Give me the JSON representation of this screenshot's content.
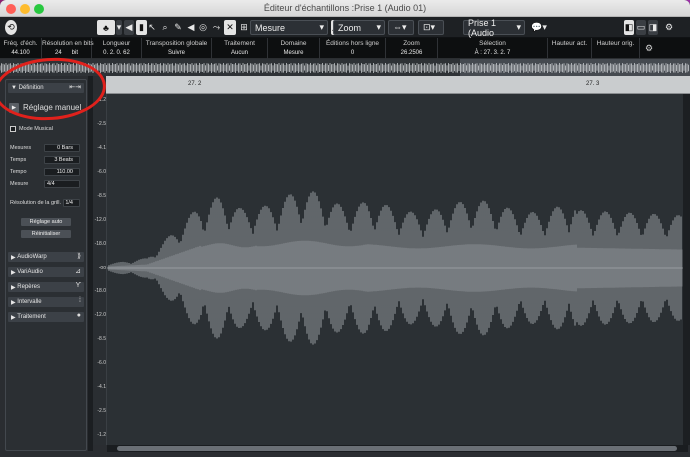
{
  "window": {
    "title": "Éditeur d'échantillons :Prise 1 (Audio 01)"
  },
  "toolbar": {
    "ruler_mode": "Mesure",
    "zoom_mode": "Zoom",
    "take": "Prise 1 (Audio"
  },
  "infobar": [
    {
      "label": "Fréq. d'éch.",
      "value": "44.100"
    },
    {
      "label": "Résolution en bits",
      "value": "24      bit"
    },
    {
      "label": "Longueur",
      "value": "0. 2. 0. 62"
    },
    {
      "label": "Transposition globale",
      "value": "Suivre"
    },
    {
      "label": "Traitement",
      "value": "Aucun"
    },
    {
      "label": "Domaine",
      "value": "Mesure"
    },
    {
      "label": "Éditions hors ligne",
      "value": "0"
    },
    {
      "label": "Zoom",
      "value": "26.2506"
    },
    {
      "label": "Sélection",
      "value": "À : 27. 3. 2. 7"
    },
    {
      "label": "Hauteur act.",
      "value": ""
    },
    {
      "label": "Hauteur orig.",
      "value": ""
    }
  ],
  "ruler": {
    "marks": [
      "27. 2",
      "27. 3"
    ]
  },
  "inspector": {
    "definition": {
      "title": "Définition",
      "manual_label": "Réglage manuel",
      "musical_mode_label": "Mode Musical",
      "fields": [
        {
          "label": "Mesures",
          "value": "0 Bars"
        },
        {
          "label": "Temps",
          "value": "3 Beats"
        },
        {
          "label": "Tempo",
          "value": "110.00"
        },
        {
          "label": "Mesure",
          "value": "4/4"
        }
      ],
      "grid_label": "Résolution de la grill.",
      "grid_value": "1/4",
      "auto_button": "Réglage auto",
      "reset_button": "Réinitialiser"
    },
    "sections": [
      "AudioWarp",
      "VariAudio",
      "Repères",
      "Intervalle",
      "Traitement"
    ]
  },
  "vscale": {
    "labels": [
      "-1.2",
      "-2.5",
      "-4.1",
      "-6.0",
      "-8.5",
      "-12.0",
      "-18.0",
      "-oo",
      "-18.0",
      "-12.0",
      "-8.5",
      "-6.0",
      "-4.1",
      "-2.5",
      "-1.2"
    ]
  },
  "colors": {
    "annotation": "#e0211c",
    "waveform": "#8e9296"
  }
}
